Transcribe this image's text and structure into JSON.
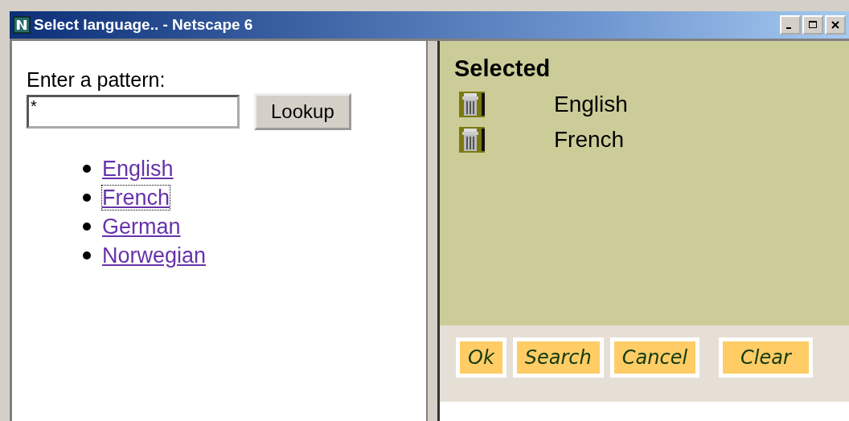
{
  "window": {
    "title": "Select language.. - Netscape 6"
  },
  "lookup": {
    "label": "Enter a pattern:",
    "value": "*",
    "button": "Lookup"
  },
  "results": [
    {
      "label": "English",
      "focused": false
    },
    {
      "label": "French",
      "focused": true
    },
    {
      "label": "German",
      "focused": false
    },
    {
      "label": "Norwegian",
      "focused": false
    }
  ],
  "selected": {
    "heading": "Selected",
    "items": [
      "English",
      "French"
    ]
  },
  "buttons": [
    "Ok",
    "Search",
    "Cancel",
    "Clear"
  ]
}
